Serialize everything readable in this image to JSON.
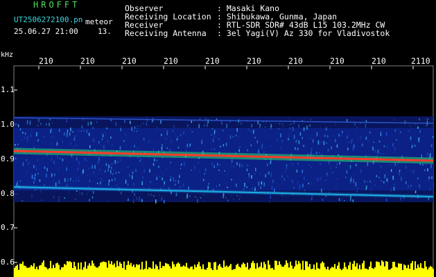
{
  "header": {
    "title": "HROFFT",
    "file_name": "UT2506272100.pn",
    "mode": "meteor",
    "datetime": "25.06.27 21:00",
    "count": "13.",
    "observer_label": "Observer",
    "observer_value": ": Masaki Kano",
    "location_label": "Receiving Location",
    "location_value": ": Shibukawa, Gunma, Japan",
    "receiver_label": "Receiver",
    "receiver_value": ": RTL-SDR SDR# 43dB L15 103.2MHz CW",
    "antenna_label": "Receiving Antenna",
    "antenna_value": ": 3el Yagi(V) Az 330 for Vladivostok"
  },
  "axis": {
    "unit": "kHz",
    "x_ticks": [
      "210",
      "210",
      "210",
      "210",
      "210",
      "210",
      "210",
      "210",
      "210",
      "2110"
    ],
    "y_ticks": [
      "1.1",
      "1.0",
      "0.9",
      "0.8",
      "0.7",
      "0.6"
    ]
  },
  "colors": {
    "text_cyan": "#3fd6e0",
    "text_white": "#ffffff",
    "title_green": "#4ee05a",
    "noise_floor": "#0a1a6e",
    "signal_line": "#ff3a2a",
    "activity_bar": "#ffff00",
    "grid": "#ffffff"
  }
}
